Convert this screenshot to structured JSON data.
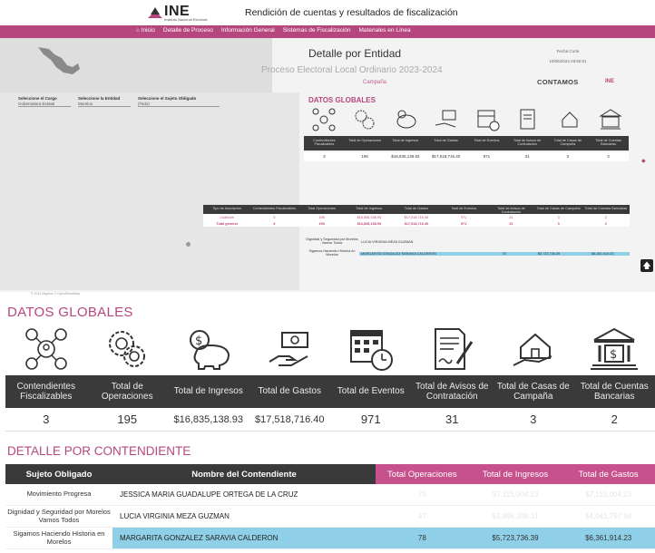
{
  "header": {
    "logo_text": "INE",
    "logo_sub": "Instituto Nacional Electoral",
    "title": "Rendición de cuentas y resultados de fiscalización"
  },
  "nav": {
    "items": [
      "Inicio",
      "Detalle de Proceso",
      "Información General",
      "Sistemas de Fiscalización",
      "Materiales en Línea"
    ]
  },
  "dashboard": {
    "detail_title": "Detalle por Entidad",
    "detail_subtitle": "Proceso Electoral Local Ordinario 2023-2024",
    "campaign": "Campaña",
    "fecha_corte_label": "Fecha Corte",
    "fecha_corte_value": "10/06/2024 03:50:01",
    "contamos": "CONTAMOS",
    "contamos_ine": "INE",
    "filters": [
      {
        "label": "Seleccione el Cargo",
        "value": "Gobernatura Estatal"
      },
      {
        "label": "Seleccione la Entidad",
        "value": "Morelos"
      },
      {
        "label": "Seleccione el Sujeto Obligado",
        "value": "(Todo)"
      }
    ],
    "map_footer": "© 2024 Mapbox © OpenStreetMap",
    "small_title": "DATOS GLOBALES",
    "small_headers": [
      "Contendientes Fiscalizables",
      "Total de Operaciones",
      "Total de Ingresos",
      "Total de Gastos",
      "Total de Eventos",
      "Total de Avisos de Contratación",
      "Total de Casas de Campaña",
      "Total de Cuentas Bancarias"
    ],
    "small_values": [
      "3",
      "195",
      "$16,835,138.93",
      "$17,518,716.40",
      "971",
      "31",
      "3",
      "2"
    ],
    "mini_headers": [
      "Tipo de Asociación",
      "Contendientes Fiscalizables",
      "Total Operaciones",
      "Total de Ingresos",
      "Total de Gastos",
      "Total de Eventos",
      "Total de Avisos de Contratación",
      "Total de Casas de Campaña",
      "Total de Cuentas Bancarias"
    ],
    "mini_rows": [
      [
        "Coalición",
        "3",
        "195",
        "$16,835,138.93",
        "$17,518,716.40",
        "971",
        "31",
        "3",
        "2"
      ],
      [
        "Total general",
        "3",
        "195",
        "$16,835,138.93",
        "$17,518,716.40",
        "971",
        "31",
        "3",
        "2"
      ]
    ],
    "mini2_rows": [
      {
        "a": "Dignidad y Seguridad por Morelos Vamos Todos",
        "b": "LUCIA VIRGINIA MEZA GUZMAN",
        "c": [
          "",
          "",
          ""
        ]
      },
      {
        "a": "Sigamos Haciendo Historia en Morelos",
        "b": "MARGARITA GONZALEZ SARAVIA CALDERON",
        "c": [
          "78",
          "$5,723,736.39",
          "$6,361,914.23"
        ]
      }
    ]
  },
  "datos_globales": {
    "title": "DATOS GLOBALES",
    "icons": [
      "network-people-icon",
      "gears-coins-icon",
      "piggy-bank-icon",
      "hand-money-icon",
      "calendar-clock-icon",
      "contract-pen-icon",
      "house-hand-icon",
      "bank-icon"
    ],
    "headers": [
      "Contendientes Fiscalizables",
      "Total de Operaciones",
      "Total de Ingresos",
      "Total de Gastos",
      "Total de Eventos",
      "Total de Avisos de Contratación",
      "Total de Casas de Campaña",
      "Total de Cuentas Bancarias"
    ],
    "values": [
      "3",
      "195",
      "$16,835,138.93",
      "$17,518,716.40",
      "971",
      "31",
      "3",
      "2"
    ]
  },
  "detalle": {
    "title": "DETALLE POR CONTENDIENTE",
    "headers": [
      "Sujeto Obligado",
      "Nombre del Contendiente",
      "Total Operaciones",
      "Total de Ingresos",
      "Total de Gastos"
    ],
    "rows": [
      {
        "sujeto": "Movimiento Progresa",
        "nombre": "JESSICA MARIA GUADALUPE ORTEGA DE LA CRUZ",
        "ops": "70",
        "ingresos": "$7,115,004.23",
        "gastos": "$7,115,004.23"
      },
      {
        "sujeto": "Dignidad y Seguridad por Morelos Vamos Todos",
        "nombre": "LUCIA VIRGINIA MEZA GUZMAN",
        "ops": "47",
        "ingresos": "$3,996,398.31",
        "gastos": "$4,041,797.94"
      },
      {
        "sujeto": "Sigamos Haciendo Historia en Morelos",
        "nombre": "MARGARITA GONZALEZ SARAVIA CALDERON",
        "ops": "78",
        "ingresos": "$5,723,736.39",
        "gastos": "$6,361,914.23"
      }
    ]
  }
}
